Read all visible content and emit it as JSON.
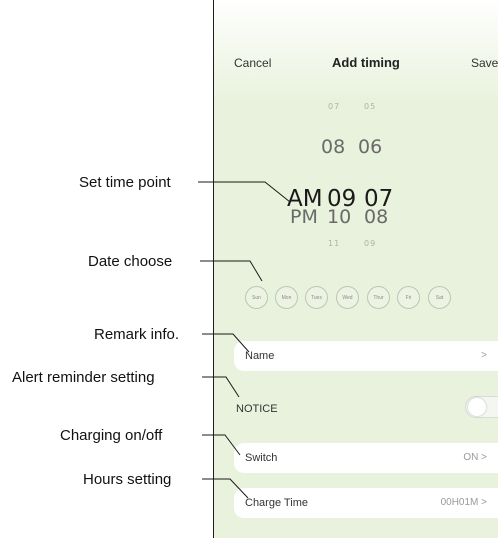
{
  "header": {
    "cancel_label": "Cancel",
    "title": "Add timing",
    "save_label": "Save"
  },
  "time_picker": {
    "ampm_above": "",
    "ampm_selected": "AM",
    "ampm_below": "PM",
    "hours": [
      "07",
      "08",
      "09",
      "10",
      "11"
    ],
    "minutes": [
      "05",
      "06",
      "07",
      "08",
      "09"
    ],
    "selected_hour": "09",
    "selected_minute": "07"
  },
  "days": [
    "Sun",
    "Mon",
    "Tues",
    "Wed",
    "Thur",
    "Fri",
    "Sat"
  ],
  "remark": {
    "label": "Name",
    "chevron": ">"
  },
  "notice": {
    "label": "NOTICE",
    "toggle_on": false
  },
  "switch_row": {
    "label": "Switch",
    "value": "ON >"
  },
  "charge_time": {
    "label": "Charge Time",
    "value": "00H01M >"
  },
  "annotations": {
    "set_time_point": "Set time point",
    "date_choose": "Date choose",
    "remark_info": "Remark info.",
    "alert_reminder": "Alert reminder setting",
    "charging_onoff": "Charging on/off",
    "hours_setting": "Hours setting"
  },
  "colors": {
    "panel_green": "#e8f2dc",
    "card_white": "#ffffff",
    "annotation_text": "#111111"
  }
}
